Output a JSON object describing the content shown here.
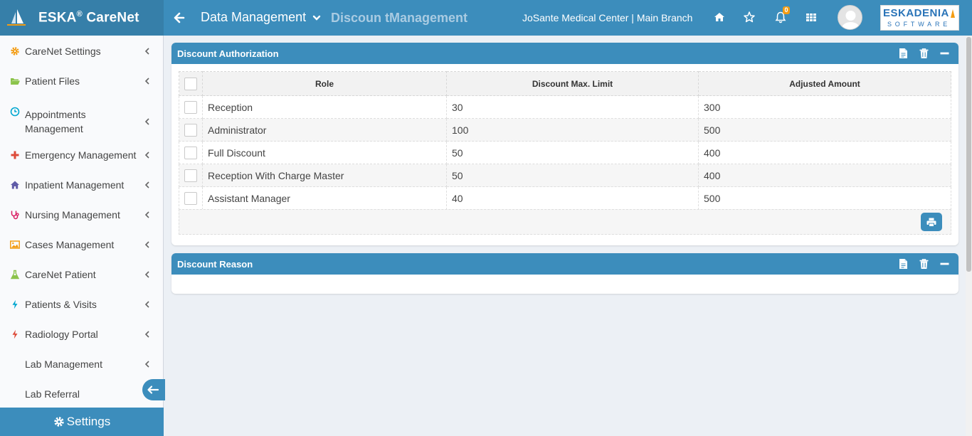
{
  "header": {
    "brand": "ESKA",
    "brand_reg": "®",
    "brand_suffix": " CareNet",
    "breadcrumb_main": "Data Management",
    "breadcrumb_sub": "Discoun tManagement",
    "organization": "JoSante Medical Center | Main Branch",
    "notification_count": "0",
    "company_logo_line1": "ESKADENIA",
    "company_logo_line2": "SOFTWARE"
  },
  "sidebar": {
    "items": [
      {
        "label": "CareNet Settings",
        "icon": "gear-icon",
        "color": "#f39c12"
      },
      {
        "label": "Patient Files",
        "icon": "folder-open-icon",
        "color": "#8bc34a"
      },
      {
        "label": "Appointments Management",
        "icon": "clock-icon",
        "color": "#00a7d0"
      },
      {
        "label": "Emergency Management",
        "icon": "plus-icon",
        "color": "#dd4b39"
      },
      {
        "label": "Inpatient Management",
        "icon": "home-icon",
        "color": "#605ca8"
      },
      {
        "label": "Nursing Management",
        "icon": "stethoscope-icon",
        "color": "#d81b60"
      },
      {
        "label": "Cases Management",
        "icon": "image-icon",
        "color": "#f39c12"
      },
      {
        "label": "CareNet Patient",
        "icon": "flask-icon",
        "color": "#8bc34a"
      },
      {
        "label": "Patients & Visits",
        "icon": "bolt-icon",
        "color": "#00a7d0"
      },
      {
        "label": "Radiology Portal",
        "icon": "bolt-icon",
        "color": "#dd4b39"
      },
      {
        "label": "Lab Management",
        "icon": "",
        "color": ""
      },
      {
        "label": "Lab Referral",
        "icon": "",
        "color": ""
      }
    ],
    "settings_label": "Settings"
  },
  "discount_authorization": {
    "title": "Discount Authorization",
    "columns": [
      "Role",
      "Discount Max. Limit",
      "Adjusted Amount"
    ],
    "rows": [
      {
        "role": "Reception",
        "max_limit": "30",
        "adjusted": "300"
      },
      {
        "role": "Administrator",
        "max_limit": "100",
        "adjusted": "500"
      },
      {
        "role": "Full Discount",
        "max_limit": "50",
        "adjusted": "400"
      },
      {
        "role": "Reception With Charge Master",
        "max_limit": "50",
        "adjusted": "400"
      },
      {
        "role": "Assistant Manager",
        "max_limit": "40",
        "adjusted": "500"
      }
    ]
  },
  "discount_reason": {
    "title": "Discount Reason"
  },
  "colors": {
    "primary": "#3c8dbc",
    "primary_dark": "#367fa9",
    "badge": "#f39c12"
  }
}
